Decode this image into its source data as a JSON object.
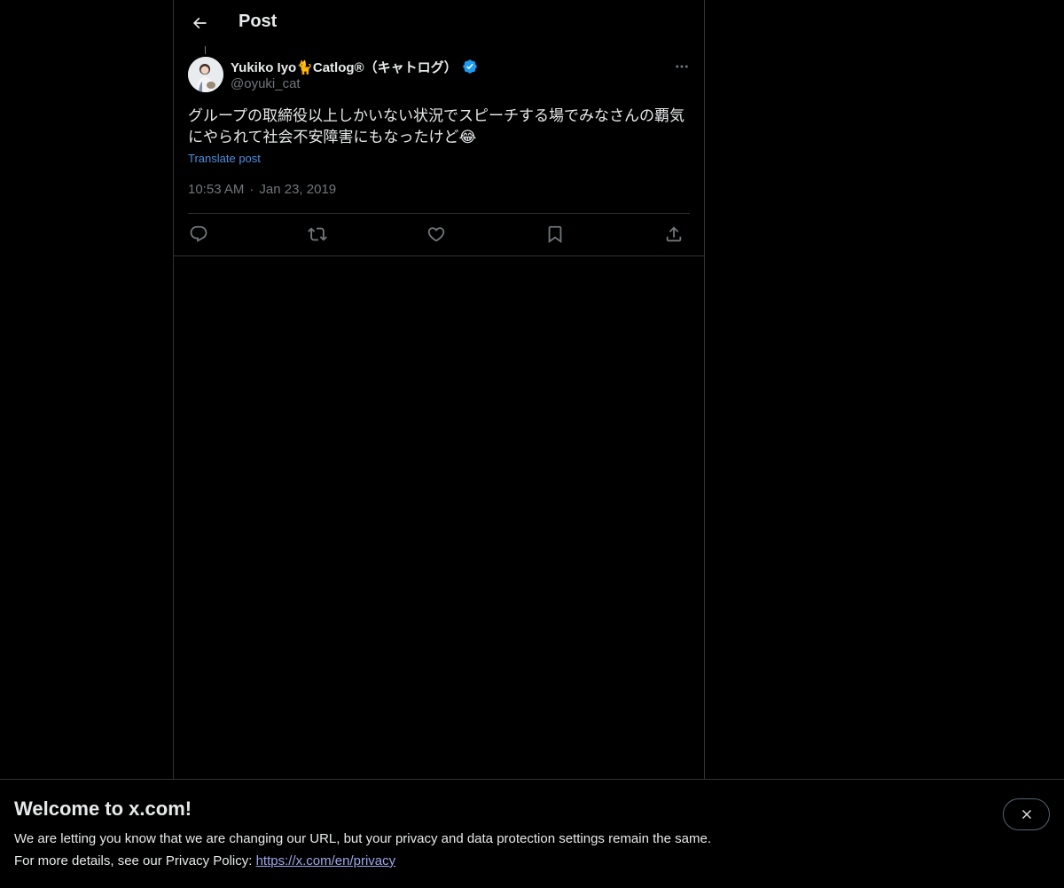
{
  "header": {
    "title": "Post"
  },
  "post": {
    "display_name": "Yukiko Iyo🐈Catlog®（キャトログ）",
    "handle": "@oyuki_cat",
    "text": "グループの取締役以上しかいない状況でスピーチする場でみなさんの覇気にやられて社会不安障害にもなったけど😂",
    "translate_label": "Translate post",
    "time": "10:53 AM",
    "separator": "·",
    "date": "Jan 23, 2019"
  },
  "banner": {
    "title": "Welcome to x.com!",
    "line1": "We are letting you know that we are changing our URL, but your privacy and data protection settings remain the same.",
    "line2_prefix": "For more details, see our Privacy Policy: ",
    "link": "https://x.com/en/privacy"
  },
  "icons": {
    "back": "back-arrow-icon",
    "verified": "verified-badge-icon",
    "more": "more-icon",
    "reply": "reply-icon",
    "repost": "repost-icon",
    "like": "like-icon",
    "bookmark": "bookmark-icon",
    "share": "share-icon",
    "close": "close-icon"
  },
  "colors": {
    "background": "#000000",
    "text": "#e7e9ea",
    "secondary_text": "#71767b",
    "accent": "#1d9bf0",
    "translate_link": "#4a8fe0",
    "border": "#2f3336"
  }
}
